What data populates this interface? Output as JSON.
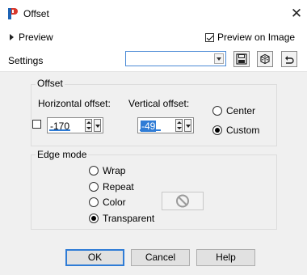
{
  "window": {
    "title": "Offset",
    "close_glyph": "✕"
  },
  "top": {
    "preview_label": "Preview",
    "preview_on_image_label": "Preview on Image",
    "preview_on_image_checked": true,
    "settings_label": "Settings",
    "settings_value": ""
  },
  "offset": {
    "group_label": "Offset",
    "horizontal_label": "Horizontal offset:",
    "horizontal_value": "-170",
    "vertical_label": "Vertical offset:",
    "vertical_value": "-49",
    "center_label": "Center",
    "custom_label": "Custom",
    "selected": "Custom"
  },
  "edge_mode": {
    "group_label": "Edge mode",
    "options": [
      "Wrap",
      "Repeat",
      "Color",
      "Transparent"
    ],
    "selected": "Transparent"
  },
  "buttons": {
    "ok": "OK",
    "cancel": "Cancel",
    "help": "Help"
  },
  "colors": {
    "accent": "#2f7cd6",
    "panel_bg": "#f0f0f0",
    "button_bg": "#e1e1e1"
  }
}
